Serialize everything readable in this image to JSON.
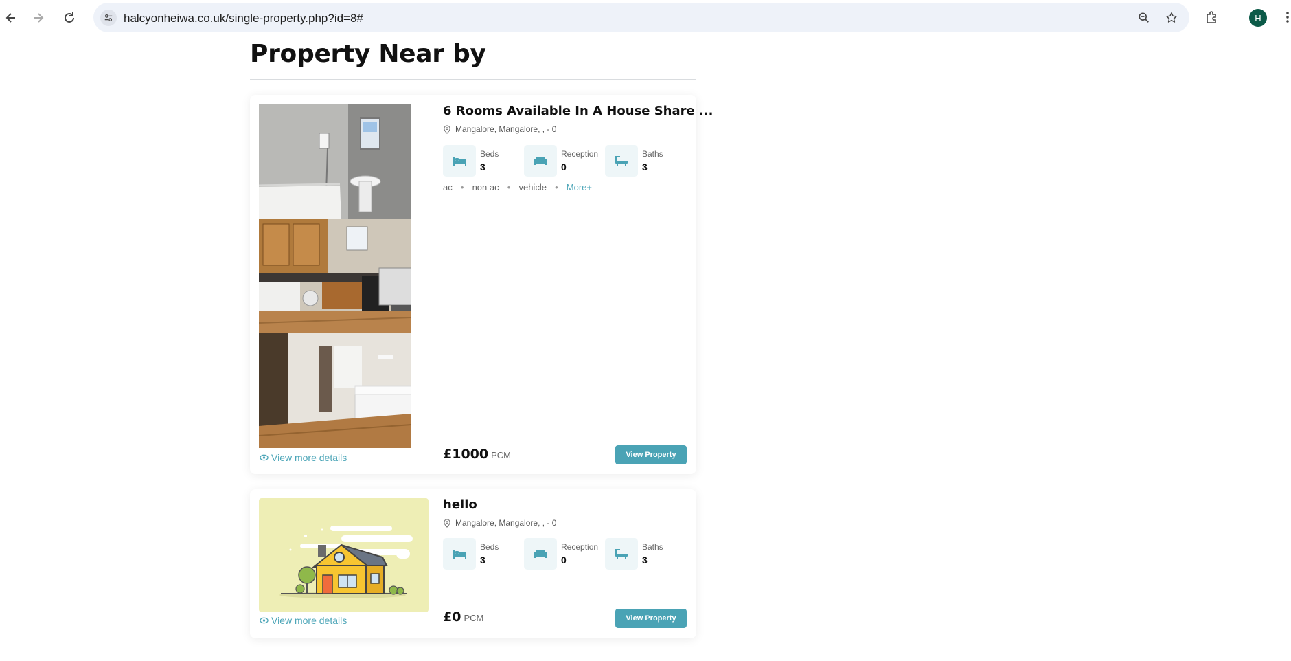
{
  "browser": {
    "url": "halcyonheiwa.co.uk/single-property.php?id=8#",
    "profile_initial": "H"
  },
  "section": {
    "title": "Property Near by"
  },
  "properties": [
    {
      "title": "6 Rooms Available In A House Share ...",
      "address": "Mangalore, Mangalore, , - 0",
      "features": [
        {
          "label": "Beds",
          "value": "3",
          "icon": "bed-icon"
        },
        {
          "label": "Reception",
          "value": "0",
          "icon": "sofa-icon"
        },
        {
          "label": "Baths",
          "value": "3",
          "icon": "bath-icon"
        }
      ],
      "amenities": [
        "ac",
        "non ac",
        "vehicle"
      ],
      "more_label": "More+",
      "details_label": "View more details",
      "price": "£1000",
      "price_unit": "PCM",
      "button_label": "View Property"
    },
    {
      "title": "hello",
      "address": "Mangalore, Mangalore, , - 0",
      "features": [
        {
          "label": "Beds",
          "value": "3",
          "icon": "bed-icon"
        },
        {
          "label": "Reception",
          "value": "0",
          "icon": "sofa-icon"
        },
        {
          "label": "Baths",
          "value": "3",
          "icon": "bath-icon"
        }
      ],
      "details_label": "View more details",
      "price": "£0",
      "price_unit": "PCM",
      "button_label": "View Property"
    }
  ],
  "colors": {
    "accent": "#4aa3b5",
    "icon_bg": "#eef6f8",
    "placeholder_bg": "#eeeeb5"
  }
}
